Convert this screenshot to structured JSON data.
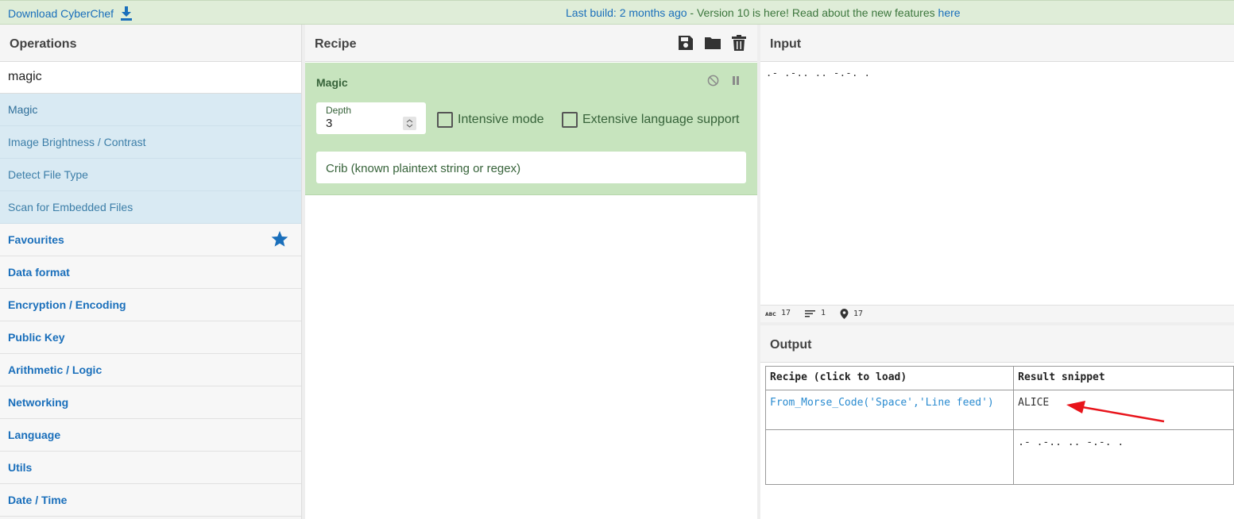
{
  "banner": {
    "download_label": "Download CyberChef",
    "last_build_link": "Last build: 2 months ago",
    "notice_text": " - Version 10 is here! Read about the new features ",
    "here_link": "here"
  },
  "operations": {
    "title": "Operations",
    "search_value": "magic",
    "results": [
      "Magic",
      "Image Brightness / Contrast",
      "Detect File Type",
      "Scan for Embedded Files"
    ],
    "categories": [
      "Favourites",
      "Data format",
      "Encryption / Encoding",
      "Public Key",
      "Arithmetic / Logic",
      "Networking",
      "Language",
      "Utils",
      "Date / Time"
    ]
  },
  "recipe": {
    "title": "Recipe",
    "operation": {
      "name": "Magic",
      "depth_label": "Depth",
      "depth_value": "3",
      "intensive_label": "Intensive mode",
      "extensive_label": "Extensive language support",
      "crib_placeholder": "Crib (known plaintext string or regex)"
    }
  },
  "input": {
    "title": "Input",
    "text": ".- .-.. .. -.-. .",
    "status": {
      "length": "17",
      "lines": "1",
      "position": "17"
    }
  },
  "output": {
    "title": "Output",
    "headers": [
      "Recipe (click to load)",
      "Result snippet"
    ],
    "rows": [
      {
        "recipe": "From_Morse_Code('Space','Line feed')",
        "snippet": "ALICE"
      },
      {
        "recipe": "",
        "snippet": ".- .-.. .. -.-. ."
      }
    ]
  },
  "colors": {
    "banner_bg": "#dfedd8",
    "link": "#1a6fbb",
    "recipe_card_bg": "#c7e4be",
    "search_result_bg": "#d9eaf3",
    "annotation_arrow": "#e8141b"
  }
}
